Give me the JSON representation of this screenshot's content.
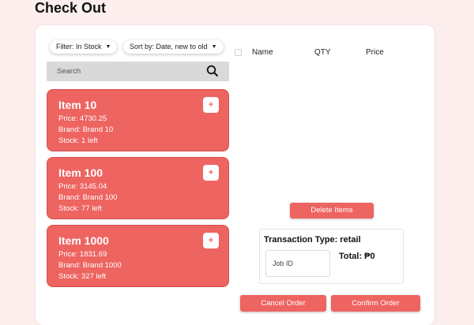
{
  "page": {
    "title": "Check Out"
  },
  "filters": {
    "filter_label": "Filter: In Stock",
    "sort_label": "Sort by: Date, new to old"
  },
  "search": {
    "placeholder": "Search"
  },
  "items": [
    {
      "name": "Item 10",
      "price": "Price: 4730.25",
      "brand": "Brand: Brand 10",
      "stock": "Stock: 1 left",
      "add_label": "+"
    },
    {
      "name": "Item 100",
      "price": "Price: 3145.04",
      "brand": "Brand: Brand 100",
      "stock": "Stock: 77 left",
      "add_label": "+"
    },
    {
      "name": "Item 1000",
      "price": "Price: 1831.69",
      "brand": "Brand: Brand 1000",
      "stock": "Stock: 327 left",
      "add_label": "+"
    }
  ],
  "cart": {
    "columns": {
      "name": "Name",
      "qty": "QTY",
      "price": "Price"
    },
    "delete_label": "Delete Items"
  },
  "transaction": {
    "type_label": "Transaction Type: retail",
    "job_id_placeholder": "Job ID",
    "total_label": "Total: ₱0"
  },
  "actions": {
    "cancel_label": "Cancel Order",
    "confirm_label": "Confirm Order"
  },
  "colors": {
    "accent": "#ed6461",
    "background": "#fcefee"
  },
  "icons": {
    "search": "search-icon",
    "dropdown": "chevron-down-icon"
  }
}
